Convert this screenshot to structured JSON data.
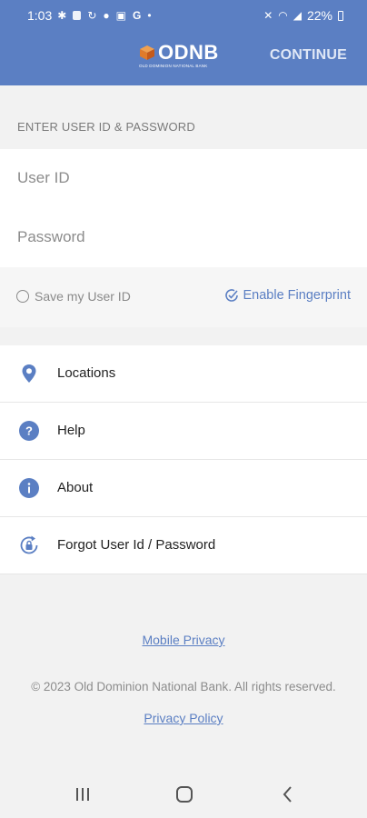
{
  "status_bar": {
    "time": "1:03",
    "battery": "22%",
    "icons": [
      "settings-icon",
      "sim-icon",
      "sync-icon",
      "person-icon",
      "gallery-icon",
      "google-icon",
      "dot-icon"
    ],
    "right_icons": [
      "mute-icon",
      "wifi-icon",
      "signal-icon",
      "battery-icon"
    ],
    "google_glyph": "G",
    "dot_glyph": "•"
  },
  "app_bar": {
    "logo_text": "ODNB",
    "logo_subtext": "OLD DOMINION NATIONAL BANK",
    "continue_label": "CONTINUE"
  },
  "login": {
    "section_title": "ENTER USER ID & PASSWORD",
    "user_id_placeholder": "User ID",
    "user_id_value": "",
    "password_placeholder": "Password",
    "password_value": "",
    "save_user_id_label": "Save my User ID",
    "save_user_id_checked": false,
    "enable_fingerprint_label": "Enable Fingerprint"
  },
  "menu": {
    "items": [
      {
        "label": "Locations",
        "icon": "location-pin-icon"
      },
      {
        "label": "Help",
        "icon": "question-icon"
      },
      {
        "label": "About",
        "icon": "info-icon"
      },
      {
        "label": "Forgot User Id / Password",
        "icon": "reset-lock-icon"
      }
    ]
  },
  "footer": {
    "mobile_privacy": "Mobile Privacy",
    "copyright": "© 2023 Old Dominion National Bank. All rights reserved.",
    "privacy_policy": "Privacy Policy"
  },
  "colors": {
    "brand_blue": "#5b7fc3",
    "logo_orange": "#e07b2a",
    "background": "#f2f2f2"
  },
  "nav_bar": {
    "buttons": [
      "recents-button",
      "home-button",
      "back-button"
    ]
  }
}
